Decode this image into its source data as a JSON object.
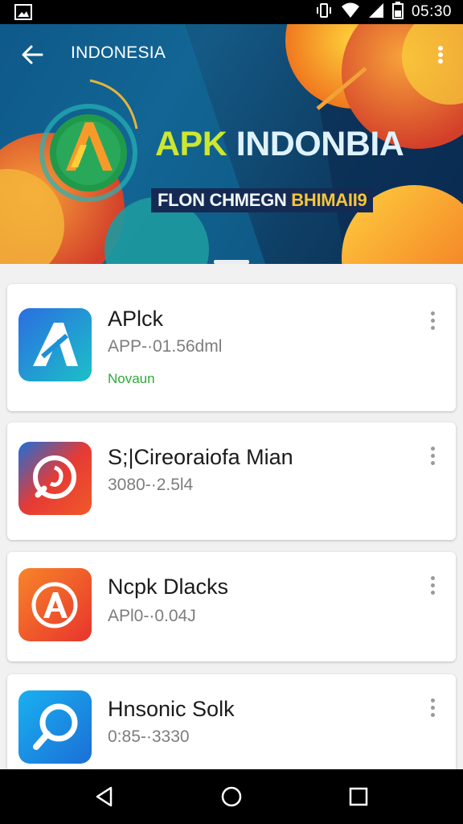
{
  "status_bar": {
    "time": "05:30",
    "icons": [
      "image-icon",
      "vibrate-icon",
      "wifi-icon",
      "signal-icon",
      "battery-icon"
    ]
  },
  "header": {
    "title": "INDONESIA",
    "back_icon": "arrow-left-icon",
    "menu_icon": "more-vert-icon"
  },
  "banner": {
    "headline_a": "APK",
    "headline_b": "INDONBIA",
    "subline_a": "FLON CHMEGN",
    "subline_b": "BHIMAII9"
  },
  "apps": [
    {
      "name": "APlck",
      "meta": "APP-·01.56dml",
      "tag": "Novaun",
      "icon": "app-a-icon",
      "color": "#1f86d8"
    },
    {
      "name": "S;|Cireoraiofa Mian",
      "meta": "3080-·2.5l4",
      "tag": "",
      "icon": "app-chat-icon",
      "color": "#e53b30"
    },
    {
      "name": "Ncpk Dlacks",
      "meta": "APl0-·0.04J",
      "tag": "",
      "icon": "app-a-circle-icon",
      "color": "#f2552a"
    },
    {
      "name": "Hnsonic Solk",
      "meta": "0:85-·3330",
      "tag": "",
      "icon": "app-search-icon",
      "color": "#1b8ae0"
    }
  ],
  "nav": {
    "back": "nav-back-icon",
    "home": "nav-home-icon",
    "recents": "nav-recents-icon"
  },
  "colors": {
    "accent_green": "#cde630",
    "tag_green": "#2fa93a",
    "banner_blue": "#145a86"
  }
}
